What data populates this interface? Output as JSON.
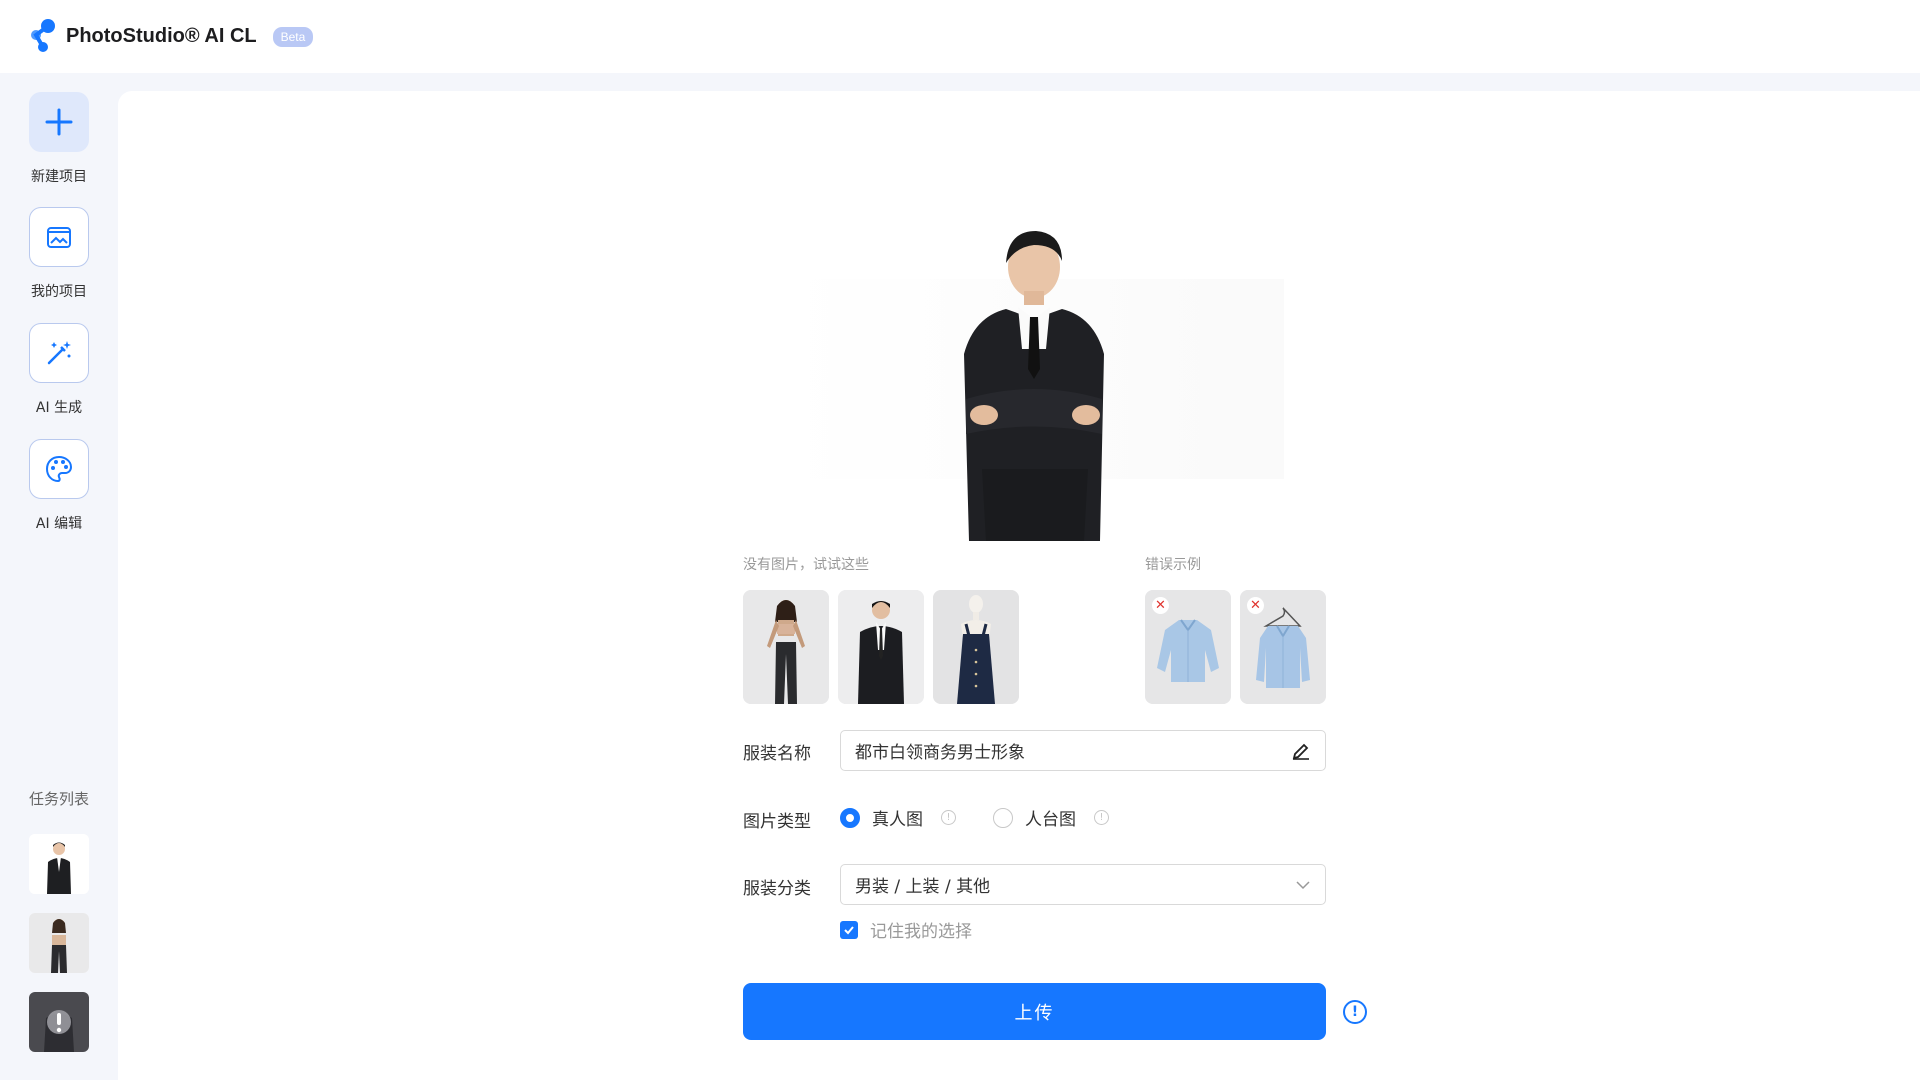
{
  "header": {
    "app_title": "PhotoStudio® AI CL",
    "beta_label": "Beta"
  },
  "sidebar": {
    "items": [
      {
        "label": "新建项目",
        "icon": "plus-icon"
      },
      {
        "label": "我的项目",
        "icon": "image-folder-icon"
      },
      {
        "label": "AI 生成",
        "icon": "magic-wand-icon"
      },
      {
        "label": "AI 编辑",
        "icon": "palette-icon"
      }
    ],
    "task_list_title": "任务列表"
  },
  "main": {
    "samples_label": "没有图片，试试这些",
    "error_examples_label": "错误示例",
    "form": {
      "name_label": "服装名称",
      "name_value": "都市白领商务男士形象",
      "type_label": "图片类型",
      "type_options": [
        "真人图",
        "人台图"
      ],
      "type_selected": "真人图",
      "category_label": "服装分类",
      "category_value": "男装 / 上装 / 其他",
      "remember_label": "记住我的选择",
      "remember_checked": true
    },
    "upload_label": "上传"
  },
  "colors": {
    "primary": "#1677ff",
    "sidebar_bg": "#f4f6fb",
    "beta_badge": "#b9c8f5",
    "error_mark": "#e0342f"
  }
}
